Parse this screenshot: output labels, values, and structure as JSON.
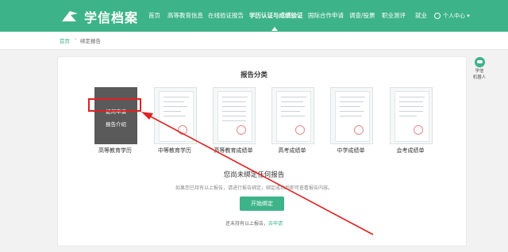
{
  "header": {
    "logo_text": "学信档案",
    "nav": [
      {
        "label": "首页"
      },
      {
        "label": "高等教育信息"
      },
      {
        "label": "在线验证报告"
      },
      {
        "label": "学历认证与成绩验证"
      },
      {
        "label": "国际合作申请"
      },
      {
        "label": "调查/投票"
      },
      {
        "label": "职业测评"
      },
      {
        "label": "就业"
      }
    ],
    "active_nav": "学历认证与成绩验证",
    "user_label": "个人中心"
  },
  "breadcrumb": {
    "home": "首页",
    "current": "绑定报告"
  },
  "main": {
    "section_title": "报告分类",
    "reports": [
      {
        "label": "高等教育学历"
      },
      {
        "label": "中等教育学历"
      },
      {
        "label": "高等教育成绩单"
      },
      {
        "label": "高考成绩单"
      },
      {
        "label": "中学成绩单"
      },
      {
        "label": "会考成绩单"
      }
    ],
    "hover_menu": {
      "apply": "如何申请",
      "intro": "报告介绍"
    },
    "empty_title": "您尚未绑定任何报告",
    "empty_desc": "如果您已持有以上报告，请进行报告绑定，绑定成功后即可查看报告内容。",
    "bind_button": "开始绑定",
    "apply_prefix": "还未持有以上报告，",
    "apply_link": "去申请"
  },
  "robot": {
    "line1": "学信",
    "line2": "机器人"
  },
  "colors": {
    "brand": "#3db389",
    "annotation": "#e02020"
  }
}
